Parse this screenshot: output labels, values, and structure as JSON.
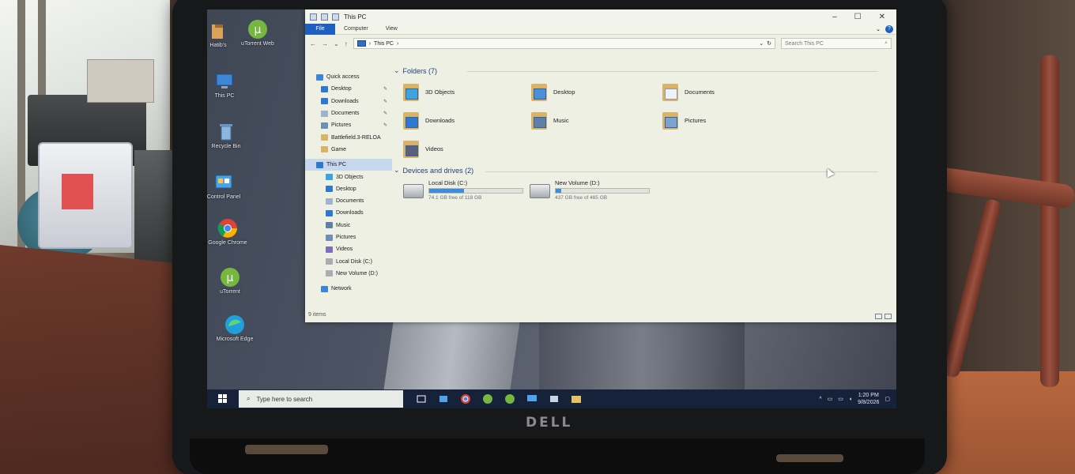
{
  "desktop": {
    "icons": [
      {
        "label": "Hatib's",
        "icon": "folder-icon"
      },
      {
        "label": "uTorrent Web",
        "icon": "utorrent-icon"
      },
      {
        "label": "This PC",
        "icon": "computer-icon"
      },
      {
        "label": "Recycle Bin",
        "icon": "recycle-bin-icon"
      },
      {
        "label": "Control Panel",
        "icon": "control-panel-icon"
      },
      {
        "label": "Google Chrome",
        "icon": "chrome-icon"
      },
      {
        "label": "uTorrent",
        "icon": "utorrent-icon"
      },
      {
        "label": "Microsoft Edge",
        "icon": "edge-icon"
      }
    ]
  },
  "explorer": {
    "title": "This PC",
    "ribbon": {
      "file": "File",
      "computer": "Computer",
      "view": "View"
    },
    "address": {
      "path": "This PC",
      "separator": "›"
    },
    "search": {
      "placeholder": "Search This PC"
    },
    "nav": {
      "quick_access": "Quick access",
      "quick_items": [
        "Desktop",
        "Downloads",
        "Documents",
        "Pictures",
        "Battlefield.3-RELOA",
        "Game"
      ],
      "this_pc": "This PC",
      "pc_items": [
        "3D Objects",
        "Desktop",
        "Documents",
        "Downloads",
        "Music",
        "Pictures",
        "Videos",
        "Local Disk (C:)",
        "New Volume (D:)"
      ],
      "network": "Network"
    },
    "folders_header": "Folders (7)",
    "folders": [
      "3D Objects",
      "Desktop",
      "Documents",
      "Downloads",
      "Music",
      "Pictures",
      "Videos"
    ],
    "drives_header": "Devices and drives (2)",
    "drives": [
      {
        "name": "Local Disk (C:)",
        "free": "74.1 GB free of 118 GB",
        "used_fraction": 0.37
      },
      {
        "name": "New Volume (D:)",
        "free": "437 GB free of 465 GB",
        "used_fraction": 0.06
      }
    ],
    "status": "9 items"
  },
  "taskbar": {
    "search_placeholder": "Type here to search",
    "time": "1:20 PM",
    "date": "9/8/2026"
  },
  "laptop": {
    "brand": "DELL"
  },
  "colors": {
    "accent": "#1f5fbf",
    "taskbar": "#16223a",
    "drive_fill": "#3c8de0",
    "folder": "#d9b36a"
  }
}
